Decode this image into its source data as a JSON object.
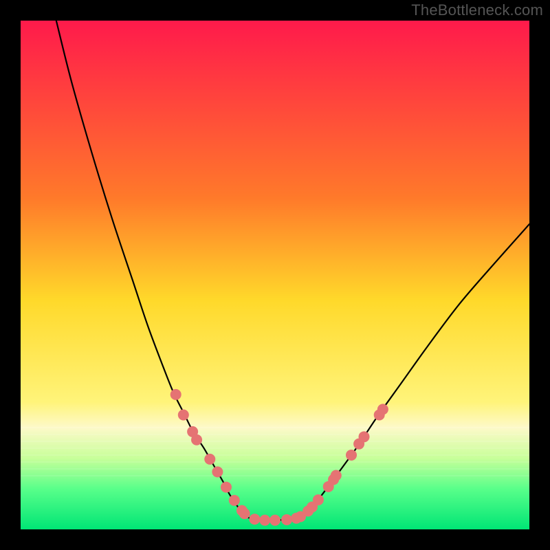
{
  "watermark": "TheBottleneck.com",
  "chart_data": {
    "type": "line",
    "title": "",
    "xlabel": "",
    "ylabel": "",
    "xlim": [
      0,
      100
    ],
    "ylim": [
      0,
      100
    ],
    "gradient_stops": [
      {
        "offset": 0,
        "color": "#ff1a4b"
      },
      {
        "offset": 35,
        "color": "#ff7a2a"
      },
      {
        "offset": 55,
        "color": "#ffd92a"
      },
      {
        "offset": 75,
        "color": "#fff47a"
      },
      {
        "offset": 80,
        "color": "#fdf9c9"
      },
      {
        "offset": 86,
        "color": "#c8ff9a"
      },
      {
        "offset": 92,
        "color": "#59ff8a"
      },
      {
        "offset": 100,
        "color": "#00e575"
      }
    ],
    "series": [
      {
        "name": "left-curve",
        "color": "#000000",
        "x": [
          7,
          10,
          14,
          18,
          22,
          25,
          28,
          30,
          32,
          34,
          36,
          38,
          40,
          41,
          42,
          43,
          44,
          45
        ],
        "y": [
          100,
          88,
          74,
          61,
          49,
          40,
          32,
          27,
          23,
          19,
          16,
          12.5,
          9,
          7,
          5.5,
          4,
          3,
          2.2
        ]
      },
      {
        "name": "floor",
        "color": "#000000",
        "x": [
          45,
          46,
          48,
          50,
          52,
          54,
          55
        ],
        "y": [
          2.2,
          2,
          1.8,
          1.8,
          1.9,
          2.1,
          2.4
        ]
      },
      {
        "name": "right-curve",
        "color": "#000000",
        "x": [
          55,
          57,
          59,
          62,
          66,
          70,
          75,
          80,
          86,
          92,
          100
        ],
        "y": [
          2.4,
          4,
          6.5,
          10.5,
          16,
          22,
          29,
          36,
          44,
          51,
          60
        ]
      }
    ],
    "scatter": {
      "name": "dots",
      "color": "#e57373",
      "radius_px": 8,
      "points": [
        {
          "x": 30.5,
          "y": 26.5
        },
        {
          "x": 32.0,
          "y": 22.5
        },
        {
          "x": 33.8,
          "y": 19.2
        },
        {
          "x": 34.6,
          "y": 17.6
        },
        {
          "x": 37.2,
          "y": 13.8
        },
        {
          "x": 38.7,
          "y": 11.3
        },
        {
          "x": 40.4,
          "y": 8.3
        },
        {
          "x": 42.0,
          "y": 5.7
        },
        {
          "x": 43.5,
          "y": 3.7
        },
        {
          "x": 44.0,
          "y": 3.1
        },
        {
          "x": 46.0,
          "y": 2.0
        },
        {
          "x": 48.0,
          "y": 1.8
        },
        {
          "x": 50.0,
          "y": 1.8
        },
        {
          "x": 52.3,
          "y": 1.9
        },
        {
          "x": 54.2,
          "y": 2.2
        },
        {
          "x": 55.0,
          "y": 2.5
        },
        {
          "x": 56.5,
          "y": 3.6
        },
        {
          "x": 57.3,
          "y": 4.4
        },
        {
          "x": 58.5,
          "y": 5.8
        },
        {
          "x": 60.5,
          "y": 8.4
        },
        {
          "x": 61.5,
          "y": 9.8
        },
        {
          "x": 62.0,
          "y": 10.6
        },
        {
          "x": 65.0,
          "y": 14.6
        },
        {
          "x": 66.5,
          "y": 16.8
        },
        {
          "x": 67.5,
          "y": 18.2
        },
        {
          "x": 70.5,
          "y": 22.5
        },
        {
          "x": 71.2,
          "y": 23.6
        }
      ]
    }
  }
}
